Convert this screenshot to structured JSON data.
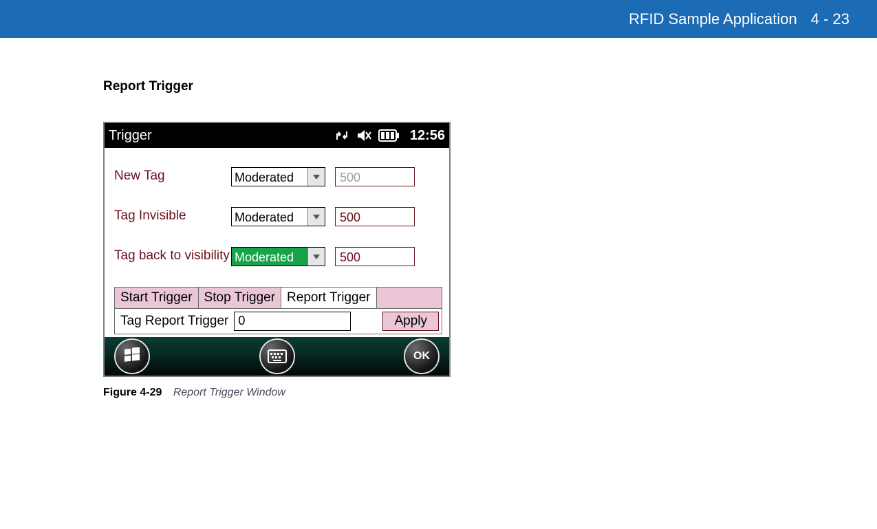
{
  "header": {
    "title": "RFID Sample Application",
    "page": "4 - 23"
  },
  "section_title": "Report Trigger",
  "device": {
    "titlebar": {
      "title": "Trigger",
      "clock": "12:56"
    },
    "rows": [
      {
        "label": "New Tag",
        "combo": "Moderated",
        "selected": false,
        "value": "500",
        "disabled": true
      },
      {
        "label": "Tag Invisible",
        "combo": "Moderated",
        "selected": false,
        "value": "500",
        "disabled": false
      },
      {
        "label": "Tag back to visibility",
        "combo": "Moderated",
        "selected": true,
        "value": "500",
        "disabled": false
      }
    ],
    "tabs": {
      "start": "Start Trigger",
      "stop": "Stop Trigger",
      "report": "Report Trigger"
    },
    "tag_report": {
      "label": "Tag Report Trigger",
      "value": "0",
      "apply": "Apply"
    },
    "sysbar": {
      "ok": "OK"
    }
  },
  "caption": {
    "label": "Figure 4-29",
    "text": "Report Trigger Window"
  }
}
